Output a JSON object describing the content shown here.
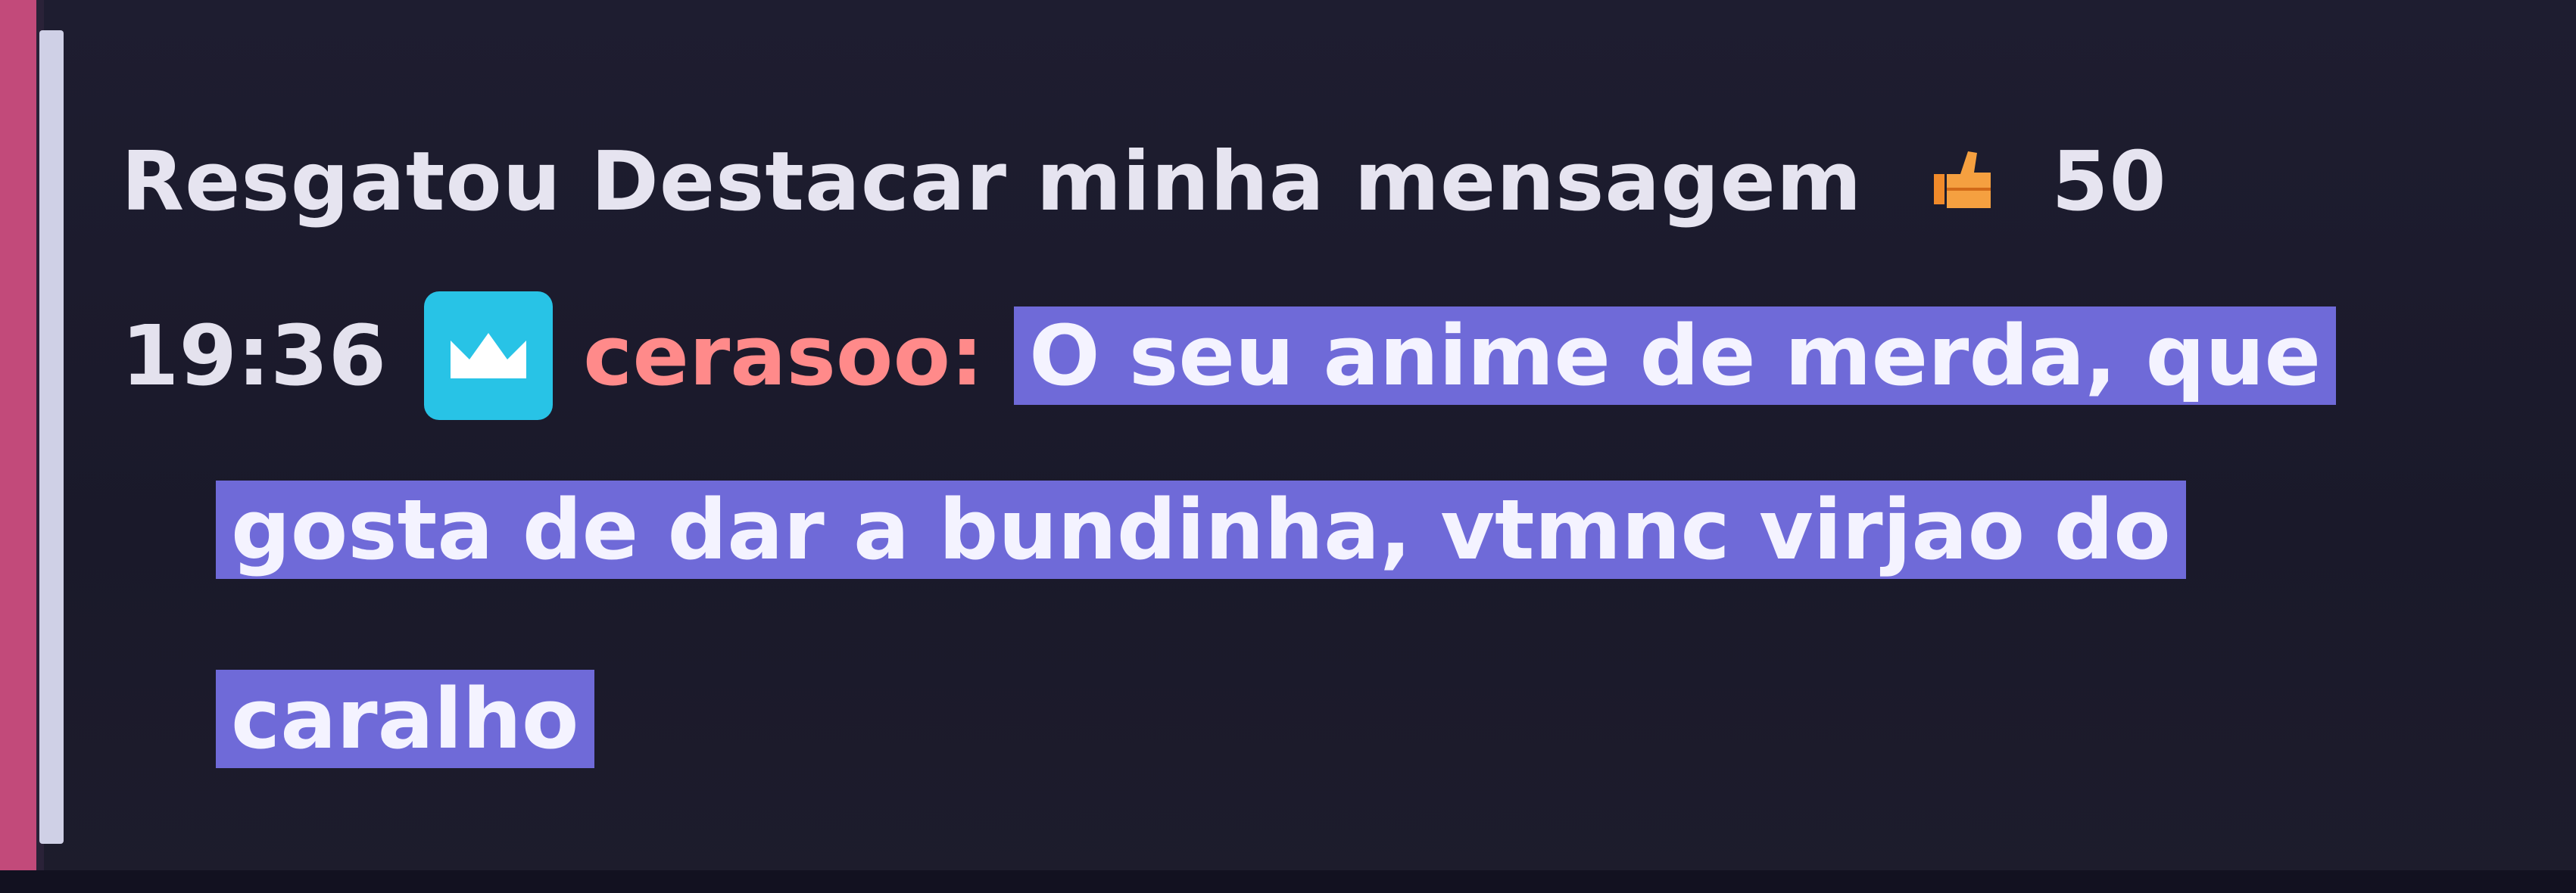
{
  "reward": {
    "label": "Resgatou Destacar minha mensagem",
    "icon": "channel-points-icon",
    "cost": "50"
  },
  "message": {
    "time": "19:36",
    "badge_icon": "crown-icon",
    "username": "cerasoo:",
    "text_line1": "O seu anime de merda, que",
    "text_line2": "gosta de dar a bundinha, vtmnc virjao do",
    "text_line3": "caralho"
  },
  "colors": {
    "highlight": "#6f6ad8",
    "badge": "#28c3e6",
    "username": "#ff8a8a",
    "left_bar": "#c24a7a"
  }
}
